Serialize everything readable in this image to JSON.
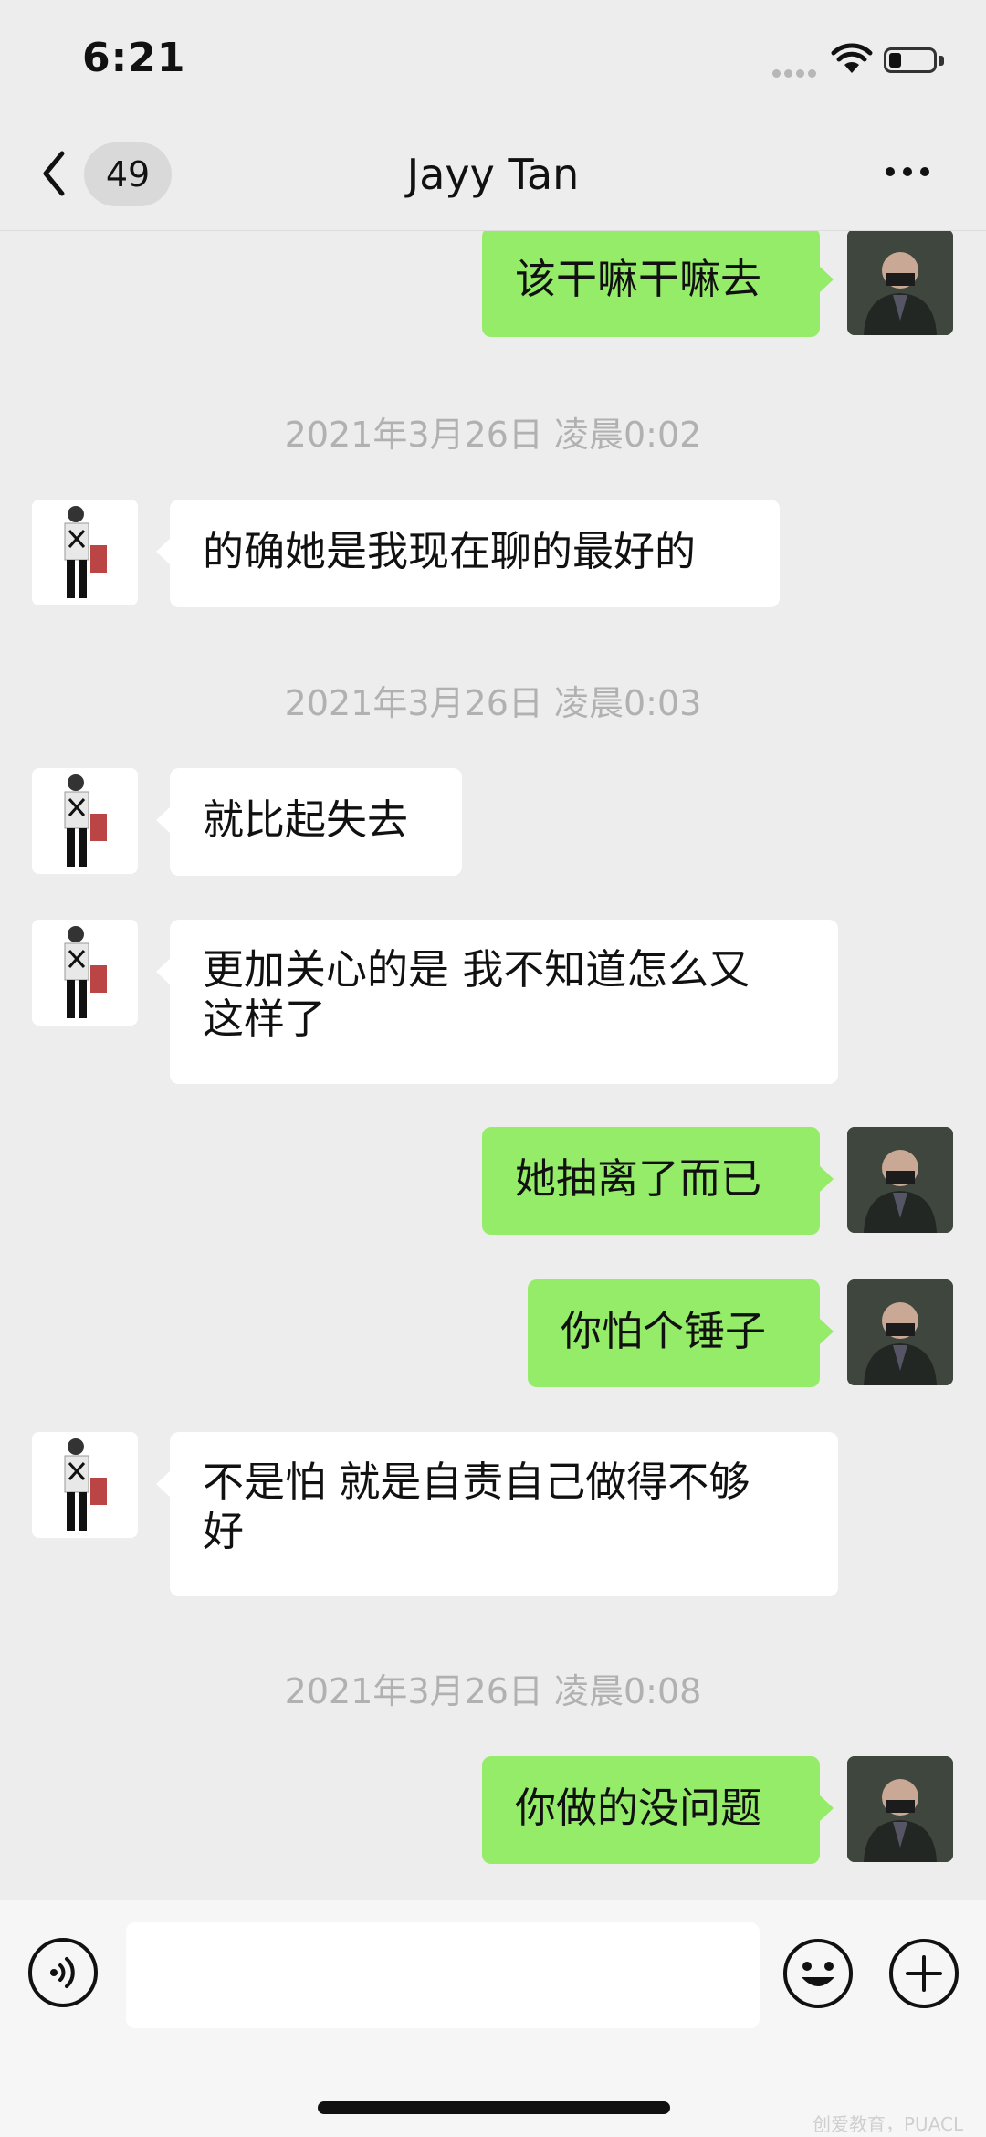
{
  "status_bar": {
    "time": "6:21"
  },
  "nav": {
    "back_count": "49",
    "title": "Jayy Tan"
  },
  "messages": [
    {
      "side": "out",
      "text": "该干嘛干嘛去"
    },
    {
      "timestamp": "2021年3月26日 凌晨0:02"
    },
    {
      "side": "in",
      "text": "的确她是我现在聊的最好的"
    },
    {
      "timestamp": "2021年3月26日 凌晨0:03"
    },
    {
      "side": "in",
      "text": "就比起失去"
    },
    {
      "side": "in",
      "text_line1": "更加关心的是 我不知道怎么又",
      "text_line2": "这样了"
    },
    {
      "side": "out",
      "text": "她抽离了而已"
    },
    {
      "side": "out",
      "text": "你怕个锤子"
    },
    {
      "side": "in",
      "text_line1": "不是怕 就是自责自己做得不够",
      "text_line2": "好"
    },
    {
      "timestamp": "2021年3月26日 凌晨0:08"
    },
    {
      "side": "out",
      "text": "你做的没问题"
    }
  ],
  "input_bar": {
    "placeholder": ""
  },
  "icons": {
    "back": "chevron-left-icon",
    "more": "more-dots-icon",
    "voice": "voice-icon",
    "emoji": "emoji-icon",
    "plus": "plus-icon"
  },
  "colors": {
    "outgoing_bubble": "#95ec69",
    "incoming_bubble": "#ffffff",
    "background": "#ededed"
  },
  "watermark": "创爱教育，PUACL"
}
